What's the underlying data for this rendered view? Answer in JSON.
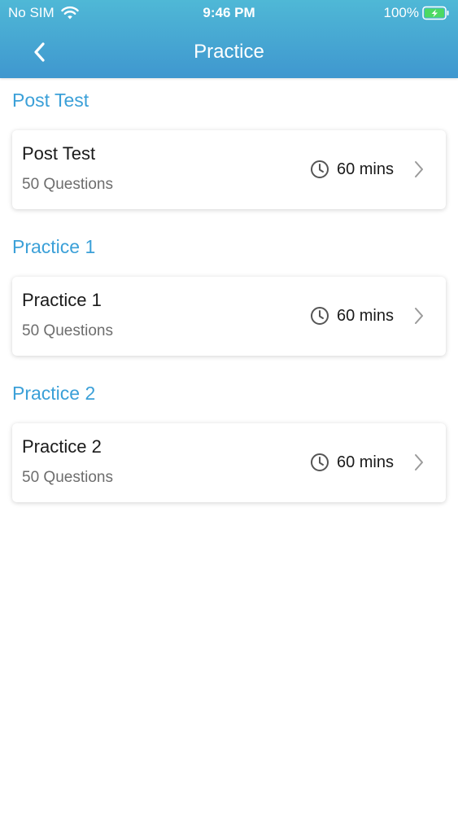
{
  "status_bar": {
    "carrier": "No SIM",
    "time": "9:46 PM",
    "battery": "100%"
  },
  "nav": {
    "title": "Practice",
    "back_icon": "chevron-left-icon"
  },
  "colors": {
    "header_top": "#4fb8d6",
    "header_bottom": "#3f97cf",
    "section_title": "#3ba0d8",
    "battery_fill": "#4cd964"
  },
  "sections": [
    {
      "title": "Post Test",
      "card": {
        "title": "Post Test",
        "questions": "50 Questions",
        "duration": "60 mins"
      }
    },
    {
      "title": "Practice 1",
      "card": {
        "title": "Practice 1",
        "questions": "50 Questions",
        "duration": "60 mins"
      }
    },
    {
      "title": "Practice 2",
      "card": {
        "title": "Practice 2",
        "questions": "50 Questions",
        "duration": "60 mins"
      }
    }
  ]
}
